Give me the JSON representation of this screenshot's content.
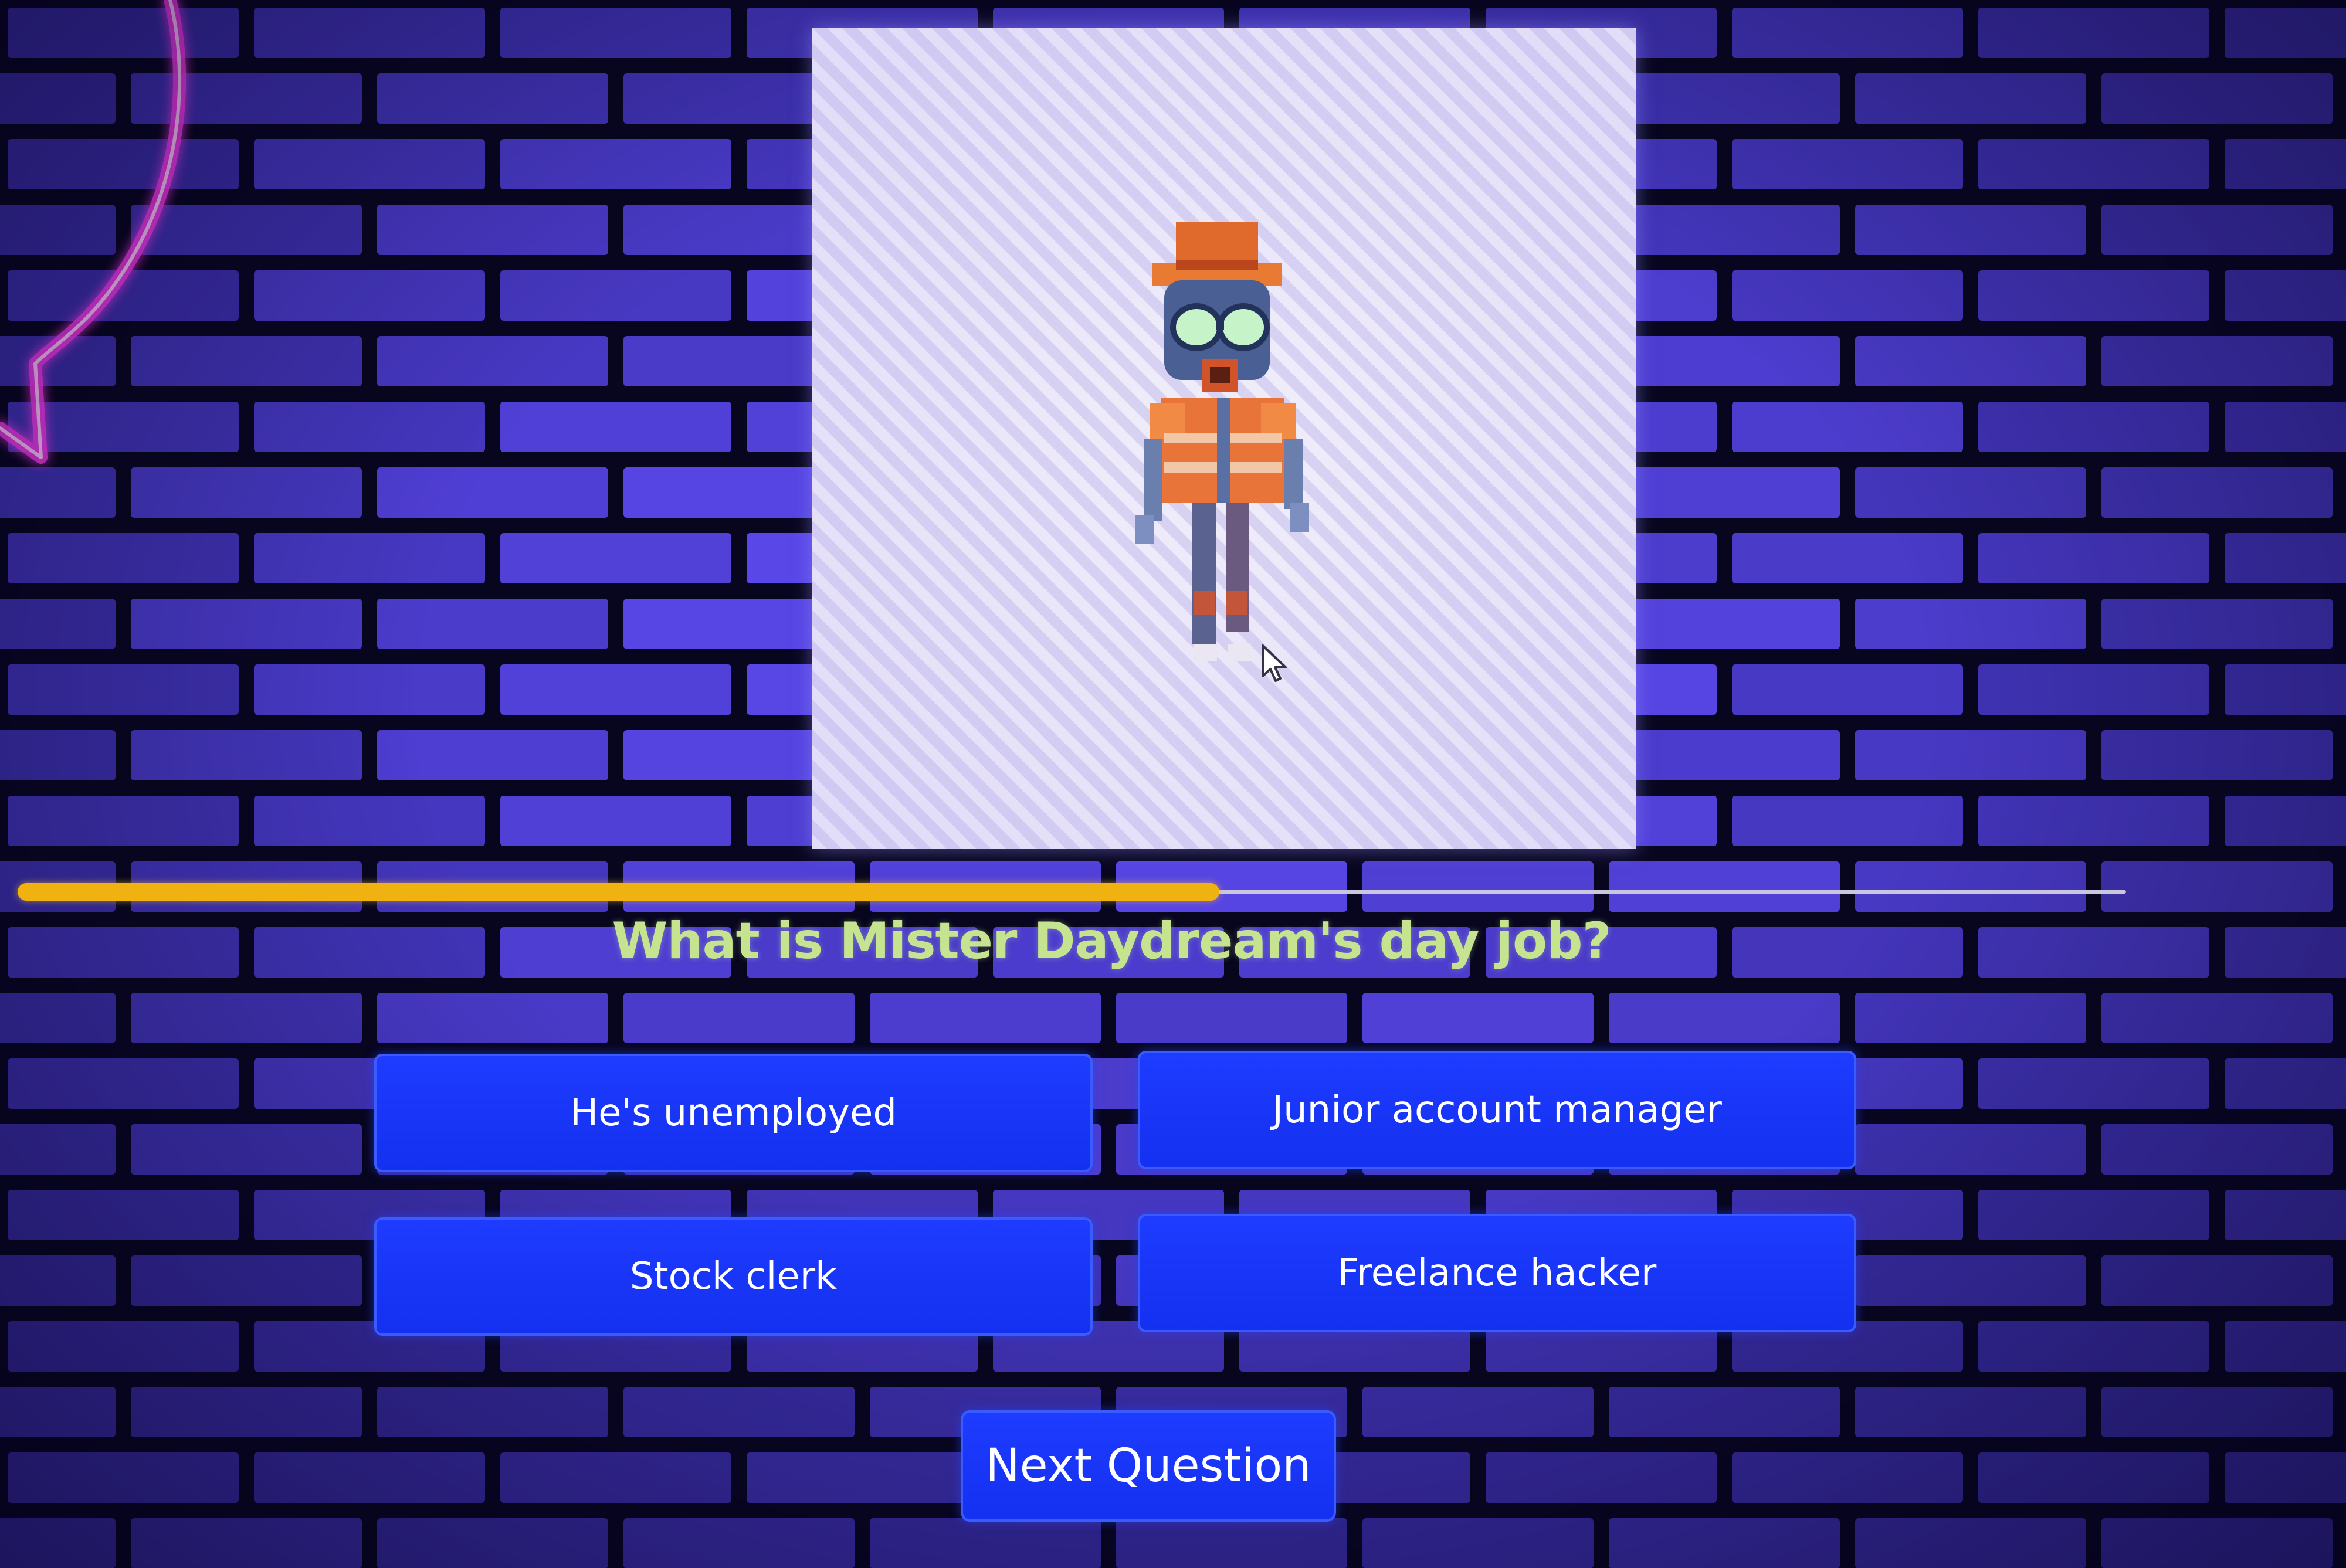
{
  "quiz": {
    "question": "What is Mister Daydream's day job?",
    "progress_fraction": 0.57,
    "answers": [
      {
        "label": "He's unemployed"
      },
      {
        "label": "Junior account manager"
      },
      {
        "label": "Stock clerk"
      },
      {
        "label": "Freelance hacker"
      }
    ],
    "next_label": "Next Question"
  },
  "icons": {
    "background": "brick-wall-icon",
    "decoration": "neon-speech-bubble-icon",
    "character": "pixel-character-icon",
    "cursor": "mouse-pointer-icon"
  },
  "colors": {
    "button_blue": "#1e3cff",
    "progress_yellow": "#f0b211",
    "question_text": "#c6e48f",
    "neon_pink": "#ff3cf0"
  }
}
